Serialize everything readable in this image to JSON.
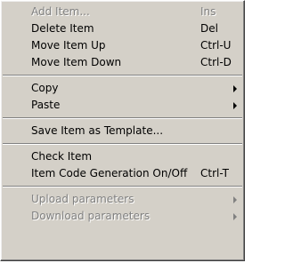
{
  "menu": {
    "items": [
      {
        "label": "Add Item...",
        "shortcut": "Ins",
        "disabled": true
      },
      {
        "label": "Delete Item",
        "shortcut": "Del"
      },
      {
        "label": "Move Item Up",
        "shortcut": "Ctrl-U"
      },
      {
        "label": "Move Item Down",
        "shortcut": "Ctrl-D"
      },
      {
        "label": "Copy",
        "submenu": true
      },
      {
        "label": "Paste",
        "submenu": true
      },
      {
        "label": "Save Item as Template..."
      },
      {
        "label": "Check Item"
      },
      {
        "label": "Item Code Generation On/Off",
        "shortcut": "Ctrl-T"
      },
      {
        "label": "Upload parameters",
        "submenu": true,
        "disabled": true
      },
      {
        "label": "Download parameters",
        "submenu": true,
        "disabled": true
      }
    ]
  },
  "colors": {
    "menu_background": "#d4d0c8",
    "text": "#000000",
    "disabled_text": "#808080"
  }
}
